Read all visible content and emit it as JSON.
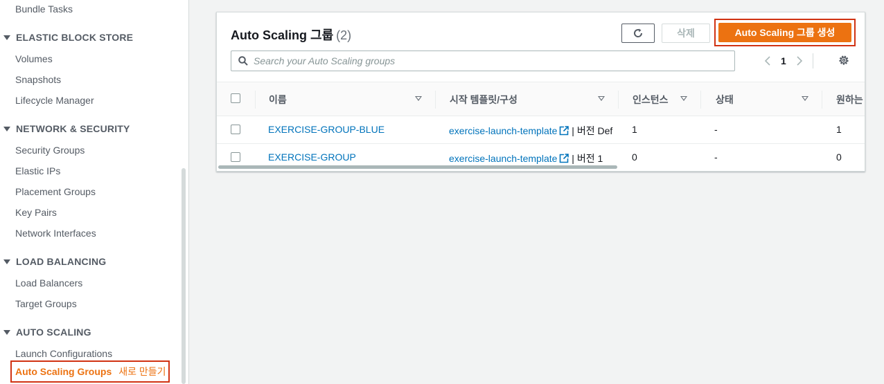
{
  "sidebar": {
    "top_item": "Bundle Tasks",
    "sections": [
      {
        "title": "ELASTIC BLOCK STORE",
        "items": [
          "Volumes",
          "Snapshots",
          "Lifecycle Manager"
        ]
      },
      {
        "title": "NETWORK & SECURITY",
        "items": [
          "Security Groups",
          "Elastic IPs",
          "Placement Groups",
          "Key Pairs",
          "Network Interfaces"
        ]
      },
      {
        "title": "LOAD BALANCING",
        "items": [
          "Load Balancers",
          "Target Groups"
        ]
      },
      {
        "title": "AUTO SCALING",
        "items": [
          "Launch Configurations"
        ]
      }
    ],
    "active_item": "Auto Scaling Groups",
    "active_badge": "새로 만들기"
  },
  "panel": {
    "title": "Auto Scaling 그룹",
    "count": "(2)",
    "delete_label": "삭제",
    "create_label": "Auto Scaling 그룹 생성",
    "search_placeholder": "Search your Auto Scaling groups",
    "page_number": "1"
  },
  "table": {
    "columns": [
      "이름",
      "시작 템플릿/구성",
      "인스턴스",
      "상태",
      "원하는"
    ],
    "rows": [
      {
        "name": "EXERCISE-GROUP-BLUE",
        "template": "exercise-launch-template",
        "version": "| 버전 Def",
        "instances": "1",
        "status": "-",
        "desired": "1"
      },
      {
        "name": "EXERCISE-GROUP",
        "template": "exercise-launch-template",
        "version": "| 버전 1",
        "instances": "0",
        "status": "-",
        "desired": "0"
      }
    ]
  },
  "colors": {
    "accent": "#ec7211",
    "highlight": "#d13212",
    "link": "#0073bb"
  }
}
